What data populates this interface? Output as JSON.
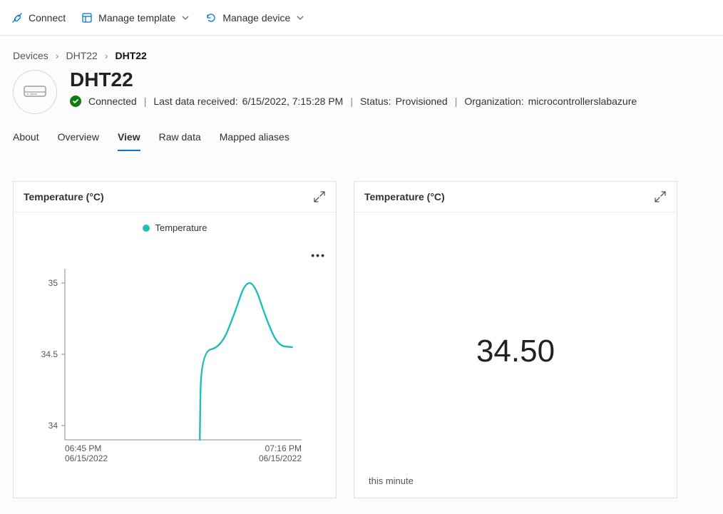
{
  "commands": {
    "connect": "Connect",
    "manage_template": "Manage template",
    "manage_device": "Manage device"
  },
  "breadcrumb": {
    "items": [
      "Devices",
      "DHT22"
    ],
    "current": "DHT22"
  },
  "header": {
    "title": "DHT22",
    "connected_label": "Connected",
    "last_data_label": "Last data received:",
    "last_data_value": "6/15/2022, 7:15:28 PM",
    "status_label": "Status:",
    "status_value": "Provisioned",
    "org_label": "Organization:",
    "org_value": "microcontrollerslabazure"
  },
  "tabs": {
    "about": "About",
    "overview": "Overview",
    "view": "View",
    "raw": "Raw data",
    "aliases": "Mapped aliases",
    "active": "view"
  },
  "card_left": {
    "title": "Temperature (°C)",
    "legend_series": "Temperature"
  },
  "card_right": {
    "title": "Temperature (°C)",
    "value": "34.50",
    "subtitle": "this minute"
  },
  "chart_data": {
    "type": "line",
    "title": "Temperature (°C)",
    "xlabel": "",
    "ylabel": "",
    "ylim": [
      33.9,
      35.1
    ],
    "y_ticks": [
      34,
      34.5,
      35
    ],
    "x_ticks": [
      {
        "label_line1": "06:45 PM",
        "label_line2": "06/15/2022"
      },
      {
        "label_line1": "07:16 PM",
        "label_line2": "06/15/2022"
      }
    ],
    "series": [
      {
        "name": "Temperature",
        "color": "#1fbfb8",
        "points": [
          {
            "x": 0.57,
            "y": 33.9
          },
          {
            "x": 0.575,
            "y": 34.52
          },
          {
            "x": 0.66,
            "y": 34.55
          },
          {
            "x": 0.72,
            "y": 34.8
          },
          {
            "x": 0.76,
            "y": 35.0
          },
          {
            "x": 0.8,
            "y": 35.0
          },
          {
            "x": 0.85,
            "y": 34.75
          },
          {
            "x": 0.9,
            "y": 34.56
          },
          {
            "x": 0.96,
            "y": 34.55
          }
        ]
      }
    ]
  }
}
